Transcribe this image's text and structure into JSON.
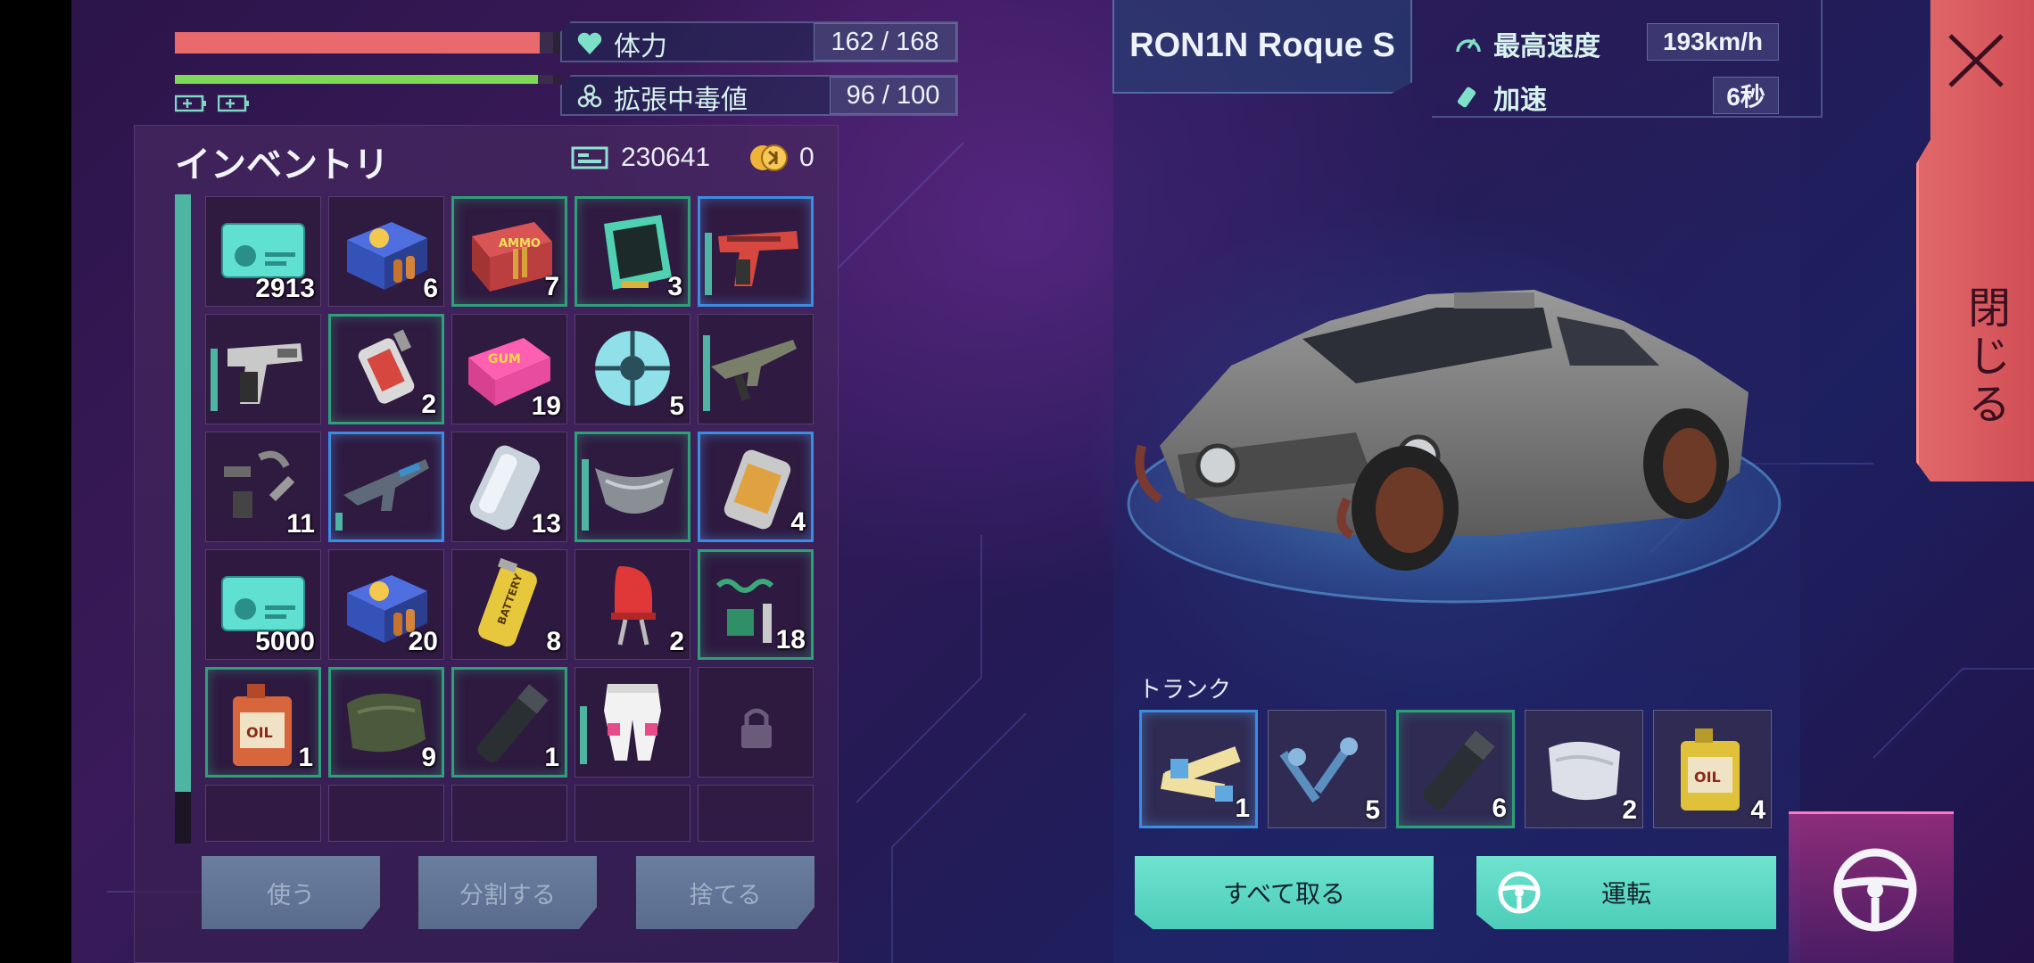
{
  "player": {
    "health_fill": 0.964,
    "mana_fill": 0.96,
    "stats": [
      {
        "label": "体力",
        "value": "162 / 168"
      },
      {
        "label": "拡張中毒値",
        "value": "96 / 100"
      }
    ]
  },
  "inventory": {
    "title": "インベントリ",
    "cash": "230641",
    "coins": "0",
    "items": [
      {
        "name": "credit-card",
        "count": "2913",
        "border": "none"
      },
      {
        "name": "ammo-box",
        "count": "6",
        "border": "none"
      },
      {
        "name": "rifle-ammo-box",
        "count": "7",
        "border": "green"
      },
      {
        "name": "data-chip",
        "count": "3",
        "border": "green"
      },
      {
        "name": "red-pistol",
        "count": "",
        "border": "blue",
        "durability": 0.7
      },
      {
        "name": "pistol",
        "count": "",
        "border": "none",
        "durability": 0.7
      },
      {
        "name": "injector",
        "count": "2",
        "border": "green"
      },
      {
        "name": "bubblegum-box",
        "count": "19",
        "border": "none"
      },
      {
        "name": "scanner-orb",
        "count": "5",
        "border": "none"
      },
      {
        "name": "assault-rifle",
        "count": "",
        "border": "none",
        "durability": 0.85
      },
      {
        "name": "gun-parts",
        "count": "11",
        "border": "none"
      },
      {
        "name": "blue-rifle",
        "count": "",
        "border": "blue",
        "durability": 0.2
      },
      {
        "name": "metal-bar",
        "count": "13",
        "border": "none"
      },
      {
        "name": "mask",
        "count": "",
        "border": "green",
        "durability": 0.8
      },
      {
        "name": "battery-cell",
        "count": "4",
        "border": "blue"
      },
      {
        "name": "credit-card",
        "count": "5000",
        "border": "none"
      },
      {
        "name": "ammo-box",
        "count": "20",
        "border": "none"
      },
      {
        "name": "battery",
        "count": "8",
        "border": "none"
      },
      {
        "name": "red-led",
        "count": "2",
        "border": "none"
      },
      {
        "name": "spring-parts",
        "count": "18",
        "border": "green"
      },
      {
        "name": "oil-can",
        "count": "1",
        "border": "green"
      },
      {
        "name": "cloth",
        "count": "9",
        "border": "green"
      },
      {
        "name": "flashlight",
        "count": "1",
        "border": "green"
      },
      {
        "name": "pants",
        "count": "",
        "border": "none",
        "durability": 0.65
      },
      {
        "name": "locked-slot",
        "count": "",
        "border": "none"
      }
    ],
    "buttons": {
      "use": "使う",
      "split": "分割する",
      "drop": "捨てる"
    }
  },
  "vehicle": {
    "name": "RON1N Roque S",
    "stats": [
      {
        "label": "最高速度",
        "value": "193km/h"
      },
      {
        "label": "加速",
        "value": "6秒"
      }
    ],
    "trunk_label": "トランク",
    "trunk": [
      {
        "name": "ribbon-cable",
        "count": "1",
        "border": "blue"
      },
      {
        "name": "screws",
        "count": "5",
        "border": "none"
      },
      {
        "name": "flashlight",
        "count": "6",
        "border": "green"
      },
      {
        "name": "cloth-roll",
        "count": "2",
        "border": "none"
      },
      {
        "name": "oil-can",
        "count": "4",
        "border": "none"
      }
    ],
    "take_all": "すべて取る",
    "drive": "運転"
  },
  "close_label": "閉じる",
  "colors": {
    "teal": "#4ccdb9",
    "health": "#e86a6d",
    "mana": "#7ed957",
    "close": "#e0686a"
  }
}
